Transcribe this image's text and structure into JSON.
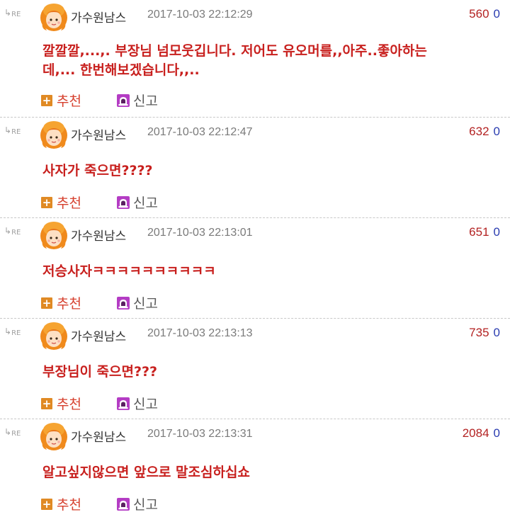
{
  "ui": {
    "re_label": "RE",
    "recommend_label": "추천",
    "report_label": "신고",
    "recommend_icon": "plus-box-icon",
    "report_icon": "siren-icon",
    "avatar_icon": "orange-hair-avatar-icon",
    "colors": {
      "body_text": "#c8201e",
      "score": "#b32222",
      "zero": "#2a3cb0",
      "recommend": "#d6402e",
      "plus_box": "#e08a24",
      "date": "#7a7a7a"
    }
  },
  "comments": [
    {
      "author": "가수원남스",
      "date": "2017-10-03 22:12:29",
      "score": "560",
      "zero": "0",
      "lines": [
        "깔깔깔,...,. 부장님 넘모웃깁니다. 저어도 유오머를,,아주..좋아하는",
        "데,... 한번해보겠습니다,,.."
      ]
    },
    {
      "author": "가수원남스",
      "date": "2017-10-03 22:12:47",
      "score": "632",
      "zero": "0",
      "lines": [
        "사자가 죽으면????"
      ]
    },
    {
      "author": "가수원남스",
      "date": "2017-10-03 22:13:01",
      "score": "651",
      "zero": "0",
      "lines": [
        "저승사자ㅋㅋㅋㅋㅋㅋㅋㅋㅋㅋ"
      ]
    },
    {
      "author": "가수원남스",
      "date": "2017-10-03 22:13:13",
      "score": "735",
      "zero": "0",
      "lines": [
        "부장님이 죽으면???"
      ]
    },
    {
      "author": "가수원남스",
      "date": "2017-10-03 22:13:31",
      "score": "2084",
      "zero": "0",
      "lines": [
        "알고싶지않으면 앞으로 말조심하십쇼"
      ]
    }
  ]
}
